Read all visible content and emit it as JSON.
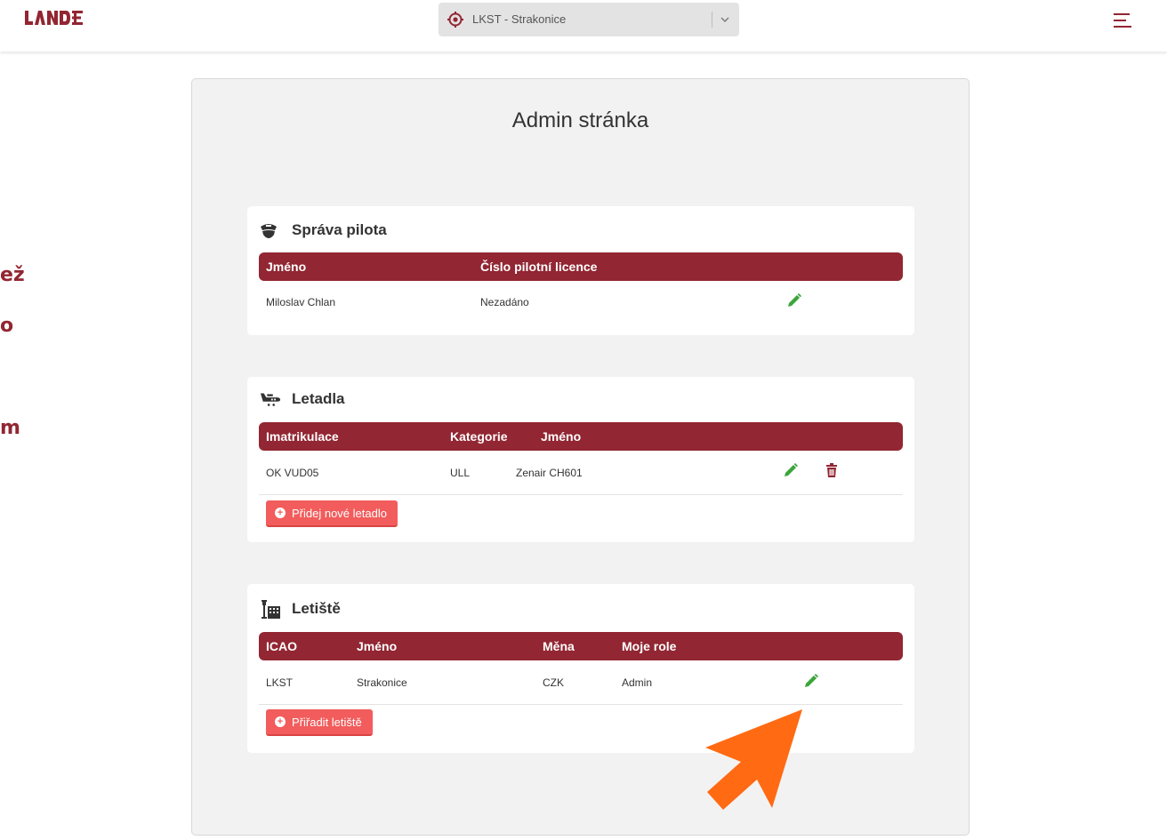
{
  "app": {
    "logo_text": "LANDE",
    "airport_selector": {
      "value": "LKST - Strakonice"
    }
  },
  "colors": {
    "brand": "#922632",
    "accent_button": "#f25c5c",
    "edit_icon": "#3aa53a",
    "delete_icon": "#922632",
    "arrow": "#ff6a13"
  },
  "side_text": [
    "ež",
    "o",
    "m"
  ],
  "page": {
    "title": "Admin stránka"
  },
  "pilot": {
    "title": "Správa pilota",
    "icon": "pilot-cap-icon",
    "columns": [
      "Jméno",
      "Číslo pilotní licence"
    ],
    "rows": [
      {
        "name": "Miloslav Chlan",
        "license": "Nezadáno"
      }
    ]
  },
  "aircraft": {
    "title": "Letadla",
    "icon": "airplane-icon",
    "columns": [
      "Imatrikulace",
      "Kategorie",
      "Jméno"
    ],
    "rows": [
      {
        "registration": "OK VUD05",
        "category": "ULL",
        "name": "Zenair CH601"
      }
    ],
    "add_button": "Přidej nové letadlo"
  },
  "airports": {
    "title": "Letiště",
    "icon": "airport-tower-icon",
    "columns": [
      "ICAO",
      "Jméno",
      "Měna",
      "Moje role"
    ],
    "rows": [
      {
        "icao": "LKST",
        "name": "Strakonice",
        "currency": "CZK",
        "role": "Admin"
      }
    ],
    "add_button": "Přiřadit letiště"
  }
}
